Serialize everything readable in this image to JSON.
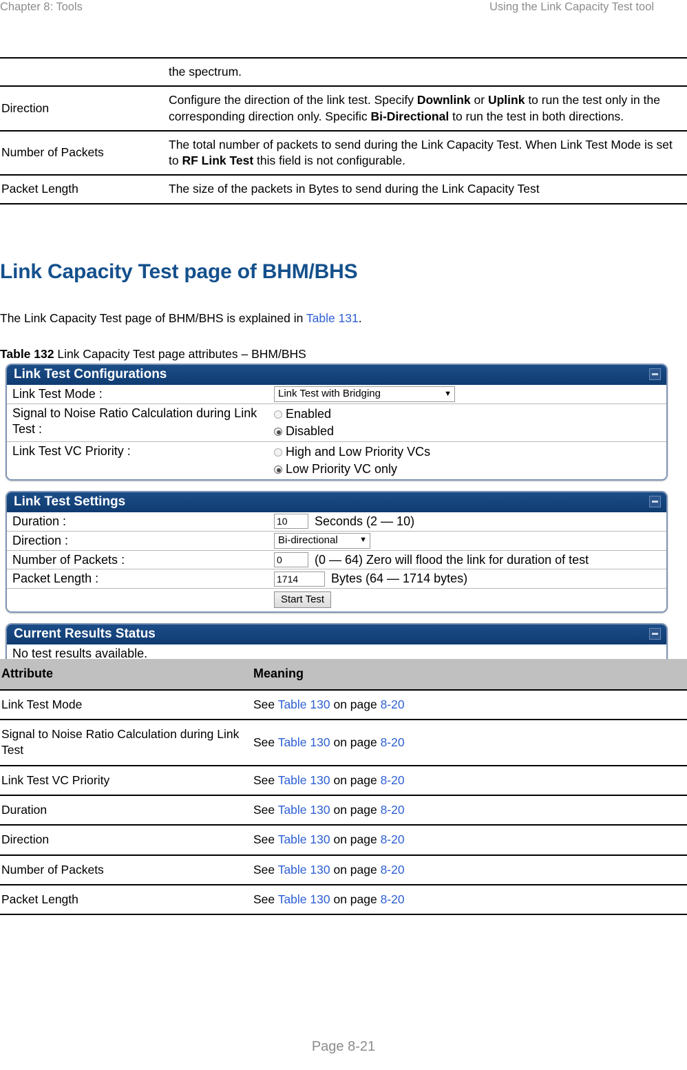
{
  "header": {
    "left": "Chapter 8:  Tools",
    "right": "Using the Link Capacity Test tool"
  },
  "top_table": {
    "rows": [
      {
        "attribute": "",
        "meaning_parts": [
          {
            "text": "the spectrum.",
            "bold": false
          }
        ]
      },
      {
        "attribute": "Direction",
        "meaning_parts": [
          {
            "text": "Configure the direction of the link test. Specify ",
            "bold": false
          },
          {
            "text": "Downlink",
            "bold": true
          },
          {
            "text": " or ",
            "bold": false
          },
          {
            "text": "Uplink",
            "bold": true
          },
          {
            "text": " to run the test only in the corresponding direction only. Specific ",
            "bold": false
          },
          {
            "text": "Bi-Directional",
            "bold": true
          },
          {
            "text": " to run the test in both directions.",
            "bold": false
          }
        ]
      },
      {
        "attribute": "Number of Packets",
        "meaning_parts": [
          {
            "text": "The total number of packets to send during the Link Capacity Test. When Link Test Mode is set to ",
            "bold": false
          },
          {
            "text": "RF Link Test",
            "bold": true
          },
          {
            "text": " this field is not configurable.",
            "bold": false
          }
        ]
      },
      {
        "attribute": "Packet Length",
        "meaning_parts": [
          {
            "text": "The size of the packets in Bytes to send during the Link Capacity Test",
            "bold": false
          }
        ]
      }
    ]
  },
  "section": {
    "heading": "Link Capacity Test page of BHM/BHS",
    "paragraph_before": "The Link Capacity Test page of BHM/BHS is explained in ",
    "paragraph_link": "Table 131",
    "paragraph_after": ".",
    "caption_number": "Table 132",
    "caption_text": "  Link Capacity Test page attributes – BHM/BHS"
  },
  "screenshot": {
    "panel1": {
      "title": "Link Test Configurations",
      "collapse_icon": "minus-icon",
      "rows": [
        {
          "label": "Link Test Mode :",
          "control": "select",
          "value": "Link Test with Bridging",
          "caret": "▼"
        },
        {
          "label": "Signal to Noise Ratio Calculation during Link Test :",
          "control": "radio-group",
          "options": [
            {
              "label": "Enabled",
              "selected": false
            },
            {
              "label": "Disabled",
              "selected": true
            }
          ]
        },
        {
          "label": "Link Test VC Priority :",
          "control": "radio-group",
          "options": [
            {
              "label": "High and Low Priority VCs",
              "selected": false
            },
            {
              "label": "Low Priority VC only",
              "selected": true
            }
          ]
        }
      ]
    },
    "panel2": {
      "title": "Link Test Settings",
      "collapse_icon": "minus-icon",
      "rows": [
        {
          "label": "Duration :",
          "control": "text",
          "value": "10",
          "hint": "Seconds (2 — 10)"
        },
        {
          "label": "Direction :",
          "control": "select",
          "value": "Bi-directional",
          "caret": "▼"
        },
        {
          "label": "Number of Packets :",
          "control": "text",
          "value": "0",
          "hint": "(0 — 64) Zero will flood the link for duration of test"
        },
        {
          "label": "Packet Length :",
          "control": "text",
          "value": "1714",
          "hint": "Bytes (64 — 1714 bytes)"
        }
      ],
      "start_button": "Start Test"
    },
    "panel3": {
      "title": "Current Results Status",
      "collapse_icon": "minus-icon",
      "status": "No test results available."
    }
  },
  "attr_table": {
    "headers": [
      "Attribute",
      "Meaning"
    ],
    "see_prefix": "See ",
    "on_page": " on page ",
    "rows": [
      {
        "attribute": "Link Test Mode",
        "table_link": "Table 130",
        "page_link": "8-20"
      },
      {
        "attribute": "Signal to Noise Ratio Calculation during Link Test",
        "table_link": "Table 130",
        "page_link": "8-20"
      },
      {
        "attribute": "Link Test VC Priority",
        "table_link": "Table 130",
        "page_link": "8-20"
      },
      {
        "attribute": "Duration",
        "table_link": "Table 130",
        "page_link": "8-20"
      },
      {
        "attribute": "Direction",
        "table_link": "Table 130",
        "page_link": "8-20"
      },
      {
        "attribute": "Number of Packets",
        "table_link": "Table 130",
        "page_link": "8-20"
      },
      {
        "attribute": "Packet Length",
        "table_link": "Table 130",
        "page_link": "8-20"
      }
    ]
  },
  "footer": {
    "page": "Page 8-21"
  },
  "colors": {
    "heading_blue": "#14508c",
    "link_blue": "#2d5fd4",
    "panel_title_bg": "#123f76",
    "table_header_bg": "#c0c0c0"
  }
}
